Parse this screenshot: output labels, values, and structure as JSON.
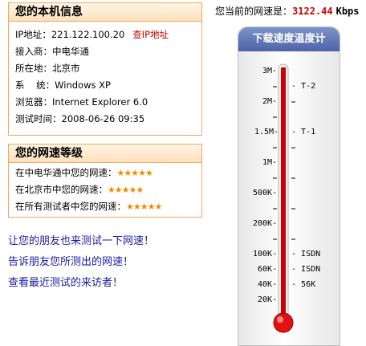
{
  "info": {
    "title": "您的本机信息",
    "rows": [
      {
        "label": "IP地址：",
        "value": "221.122.100.20"
      },
      {
        "label": "接入商：",
        "value": "中电华通"
      },
      {
        "label": "所在地：",
        "value": "北京市"
      },
      {
        "label": "系    统：",
        "value": "Windows XP"
      },
      {
        "label": "浏览器：",
        "value": "Internet Explorer 6.0"
      },
      {
        "label": "测试时间：",
        "value": "2008-06-26 09:35"
      }
    ],
    "ip_link": "查IP地址"
  },
  "grade": {
    "title": "您的网速等级",
    "rows": [
      {
        "label": "在中电华通中您的网速：",
        "stars": "★★★★★"
      },
      {
        "label": "在北京市中您的网速：",
        "stars": "★★★★★"
      },
      {
        "label": "在所有测试者中您的网速：",
        "stars": "★★★★★"
      }
    ]
  },
  "links": [
    "让您的朋友也来测试一下网速！",
    "告诉朋友您所测出的网速！",
    "查看最近测试的来访者！"
  ],
  "speed": {
    "prefix": "您当前的网速是：",
    "value": "3122.44",
    "unit": "Kbps"
  },
  "thermometer": {
    "title": "下载速度温度计",
    "left_labels": [
      "3M",
      "2M",
      "1.5M",
      "1M",
      "500K",
      "200K",
      "100K",
      "60K",
      "40K",
      "20K"
    ],
    "right_labels": [
      "T-2",
      "T-1",
      "ISDN",
      "ISDN",
      "56K"
    ],
    "colors": {
      "mercury": "#cc0000",
      "bulb": "#ee1111",
      "header": "#5a70b0"
    }
  }
}
